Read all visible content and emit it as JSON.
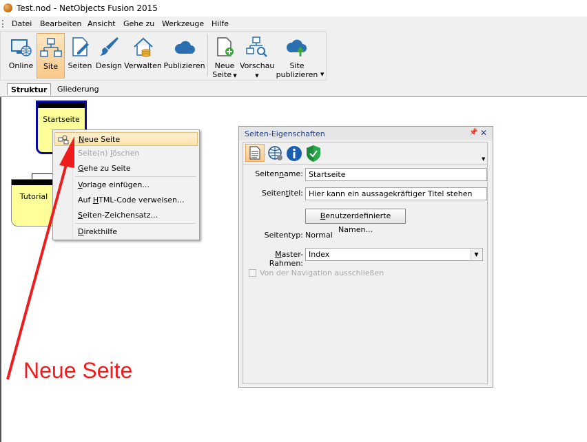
{
  "window": {
    "title": "Test.nod - NetObjects Fusion 2015"
  },
  "menubar": {
    "items": [
      "Datei",
      "Bearbeiten",
      "Ansicht",
      "Gehe zu",
      "Werkzeuge",
      "Hilfe"
    ]
  },
  "ribbon": {
    "buttons": [
      {
        "label": "Online"
      },
      {
        "label": "Site"
      },
      {
        "label": "Seiten"
      },
      {
        "label": "Design"
      },
      {
        "label": "Verwalten"
      },
      {
        "label": "Publizieren"
      },
      {
        "label": "Neue",
        "label2": "Seite"
      },
      {
        "label": "Vorschau"
      },
      {
        "label": "Site",
        "label2": "publizieren"
      }
    ]
  },
  "tabs": [
    "Struktur",
    "Gliederung"
  ],
  "sitemap": {
    "home_page": "Startseite",
    "child_page": "Tutorial"
  },
  "context_menu": {
    "items": [
      {
        "pre": "",
        "key": "N",
        "post": "eue Seite"
      },
      {
        "pre": "Seite(n) ",
        "key": "l",
        "post": "öschen"
      },
      {
        "pre": "",
        "key": "G",
        "post": "ehe zu Seite"
      },
      {
        "pre": "",
        "key": "V",
        "post": "orlage einfügen..."
      },
      {
        "pre": "Auf ",
        "key": "H",
        "post": "TML-Code verweisen..."
      },
      {
        "pre": "",
        "key": "S",
        "post": "eiten-Zeichensatz..."
      },
      {
        "pre": "",
        "key": "D",
        "post": "irekthilfe"
      }
    ]
  },
  "properties": {
    "title": "Seiten-Eigenschaften",
    "name_label_pre": "Seiten",
    "name_label_key": "n",
    "name_label_post": "ame:",
    "name_value": "Startseite",
    "title_label_pre": "Seiten",
    "title_label_key": "t",
    "title_label_post": "itel:",
    "title_value": "Hier kann ein aussagekräftiger Titel stehen",
    "custom_names_pre": "",
    "custom_names_key": "B",
    "custom_names_post": "enutzerdefinierte Namen...",
    "type_label": "Seitentyp:",
    "type_value": "Normal",
    "master_label_pre": "",
    "master_label_key": "M",
    "master_label_post": "aster-Rahmen:",
    "master_value": "Index",
    "exclude_nav_label": "Von der Navigation ausschließen"
  },
  "annotation": {
    "text": "Neue Seite",
    "color": "#ee1c1c"
  },
  "colors": {
    "page_fill": "#ffff99",
    "selection": "#0a0a9a",
    "ribbon_active": "#f9c98a"
  }
}
